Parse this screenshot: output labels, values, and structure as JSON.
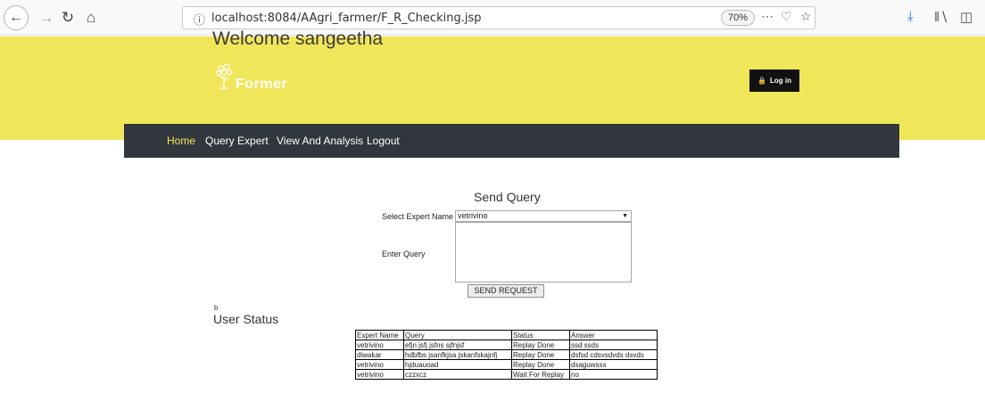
{
  "browser": {
    "url": "localhost:8084/AAgri_farmer/F_R_Checking.jsp",
    "zoom": "70%"
  },
  "header": {
    "welcome": "Welcome sangeetha",
    "logo_text": "Former",
    "login_label": "Log in",
    "background": "#f0e65a"
  },
  "nav": {
    "items": [
      {
        "label": "Home",
        "active": true
      },
      {
        "label": "Query Expert"
      },
      {
        "label": "View And Analysis"
      },
      {
        "label": "Logout"
      }
    ]
  },
  "form": {
    "title": "Send Query",
    "expert_label": "Select Expert Name",
    "expert_value": "vetrivino",
    "query_label": "Enter Query",
    "query_value": "",
    "submit_label": "SEND REQUEST"
  },
  "stray_text": "b",
  "status": {
    "title": "User Status",
    "columns": [
      "Expert Name",
      "Query",
      "Status",
      "Answer"
    ],
    "rows": [
      [
        "vetrivino",
        "efjn jsfj jsfns sjfnjsf",
        "Replay Done",
        "ssd ssds"
      ],
      [
        "diwakar",
        "hdbfbs jsanfkjsa jskanfskajnfj",
        "Replay Done",
        "dsfsd cdsvsdvds dsvds"
      ],
      [
        "vetrivino",
        "hjduauoad",
        "Replay Done",
        "dsaguwsss"
      ],
      [
        "vetrivino",
        "czzxcz",
        "Wait For Replay",
        "no"
      ]
    ]
  }
}
